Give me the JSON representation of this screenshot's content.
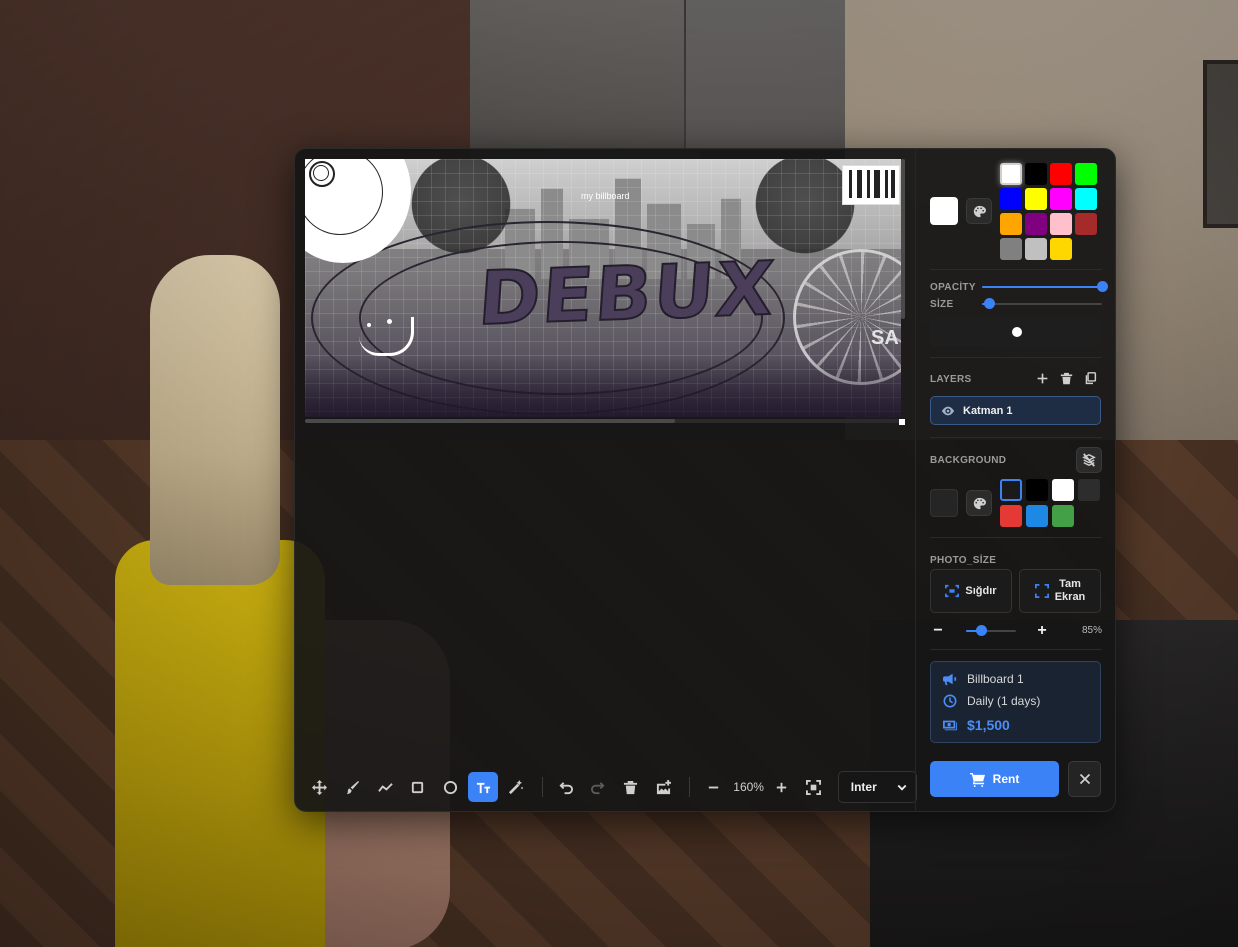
{
  "canvas": {
    "billboard_label": "my billboard",
    "graffiti_text": "DEBUX",
    "sign_text": "SA"
  },
  "toolbar": {
    "tools": [
      {
        "icon": "move-icon"
      },
      {
        "icon": "brush-icon"
      },
      {
        "icon": "line-icon"
      },
      {
        "icon": "rectangle-icon"
      },
      {
        "icon": "circle-icon"
      },
      {
        "icon": "text-icon",
        "active": true
      },
      {
        "icon": "magic-wand-icon"
      }
    ],
    "zoom_level": "160%",
    "font": "Inter"
  },
  "sidebar": {
    "colors": {
      "current": "#ffffff",
      "palette": [
        "#ffffff",
        "#000000",
        "#ff0000",
        "#00ff00",
        "#0000ff",
        "#ffff00",
        "#ff00ff",
        "#00ffff",
        "#ffa500",
        "#800080",
        "#ffc0cb",
        "#a52a2a",
        "#808080",
        "#c0c0c0",
        "#ffd700"
      ],
      "selected_index": 0
    },
    "opacity_label": "OPACİTY",
    "opacity_value": 1.0,
    "size_label": "SİZE",
    "size_value": 0.06,
    "layers_label": "LAYERS",
    "layers": [
      {
        "name": "Katman 1"
      }
    ],
    "background_label": "BACKGROUND",
    "background": {
      "current": "#252525",
      "palette": [
        "#1a1a1a",
        "#000000",
        "#ffffff",
        "#2d2d2d",
        "#e53935",
        "#1e88e5",
        "#43a047"
      ],
      "selected_index": 0
    },
    "photo_size_label": "PHOTO_SİZE",
    "fit_label": "Sığdır",
    "fullscreen_label_1": "Tam",
    "fullscreen_label_2": "Ekran",
    "photo_zoom_value": 0.3,
    "photo_zoom_pct": "85%",
    "info": {
      "billboard_name": "Billboard 1",
      "duration": "Daily (1 days)",
      "price": "$1,500"
    },
    "rent_label": "Rent",
    "accent": "#3b82f6"
  }
}
